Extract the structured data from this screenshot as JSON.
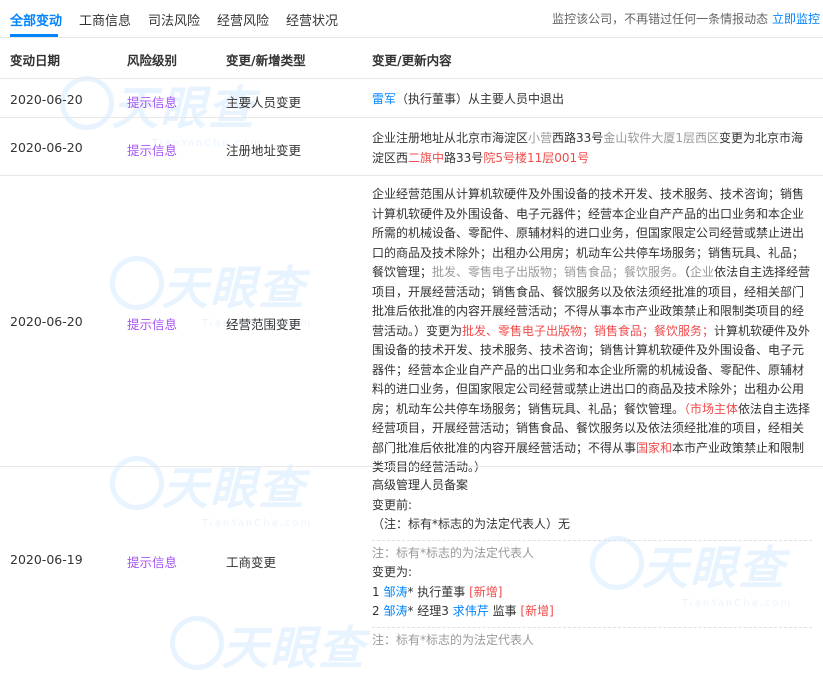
{
  "tabs": [
    "全部变动",
    "工商信息",
    "司法风险",
    "经营风险",
    "经营状况"
  ],
  "monitor": {
    "text": "监控该公司，不再错过任何一条情报动态",
    "link": "立即监控"
  },
  "headers": {
    "date": "变动日期",
    "risk": "风险级别",
    "type": "变更/新增类型",
    "content": "变更/更新内容"
  },
  "watermark": {
    "brand": "天眼查",
    "domain": "TianYanCha.com"
  },
  "rows": [
    {
      "date": "2020-06-20",
      "risk": "提示信息",
      "type": "主要人员变更",
      "c": {
        "person": "雷军",
        "rest": "（执行董事）从主要人员中退出"
      }
    },
    {
      "date": "2020-06-20",
      "risk": "提示信息",
      "type": "注册地址变更",
      "c": {
        "s1": "企业注册地址从北京市海淀区",
        "s2": "小营",
        "s3": "西路33号",
        "s4": "金山软件大厦1层西区",
        "s5": "变更为北京市海淀区西",
        "s6": "二旗中",
        "s7": "路33号",
        "s8": "院5号楼11层001号"
      }
    },
    {
      "date": "2020-06-20",
      "risk": "提示信息",
      "type": "经营范围变更",
      "c": {
        "a1": "企业经营范围从计算机软硬件及外围设备的技术开发、技术服务、技术咨询；销售计算机软硬件及外围设备、电子元器件；经营本企业自产产品的出口业务和本企业所需的机械设备、零配件、原辅材料的进口业务，但国家限定公司经营或禁止进出口的商品及技术除外；出租办公用房；机动车公共停车场服务；销售玩具、礼品；餐饮管理；",
        "a2": "批发、零售电子出版物；销售食品；餐饮服务。",
        "a3": "（",
        "a4": "企业",
        "a5": "依法自主选择经营项目，开展经营活动；销售食品、餐饮服务以及依法须经批准的项目，经相关部门批准后依批准的内容开展经营活动；不得从事本市产业政策禁止和限制类项目的经营活动。）变更为",
        "a6": "批发、零售电子出版物；销售食品；餐饮服务；",
        "a7": "计算机软硬件及外围设备的技术开发、技术服务、技术咨询；销售计算机软硬件及外围设备、电子元器件；经营本企业自产产品的出口业务和本企业所需的机械设备、零配件、原辅材料的进口业务，但国家限定公司经营或禁止进出口的商品及技术除外；出租办公用房；机动车公共停车场服务；销售玩具、礼品；餐饮管理。",
        "a8": "（市场主体",
        "a9": "依法自主选择经营项目，开展经营活动；销售食品、餐饮服务以及依法须经批准的项目，经相关部门批准后依批准的内容开展经营活动；不得从事",
        "a10": "国家和",
        "a11": "本市产业政策禁止和限制类项目的经营活动。）"
      }
    },
    {
      "date": "2020-06-19",
      "risk": "提示信息",
      "type": "工商变更",
      "c": {
        "title": "高级管理人员备案",
        "before_label": "变更前:",
        "before_value": "（注：标有*标志的为法定代表人）无",
        "note": "注：标有*标志的为法定代表人",
        "after_label": "变更为:",
        "l1_num": "1 ",
        "l1_name": "邹涛",
        "l1_rest": "* 执行董事 ",
        "l1_tag": "[新增]",
        "l2_num": "2 ",
        "l2_name": "邹涛",
        "l2_mid": "* 经理3 ",
        "l2_name2": "求伟芹",
        "l2_rest": " 监事 ",
        "l2_tag": "[新增]",
        "note2": "注：标有*标志的为法定代表人"
      }
    }
  ]
}
